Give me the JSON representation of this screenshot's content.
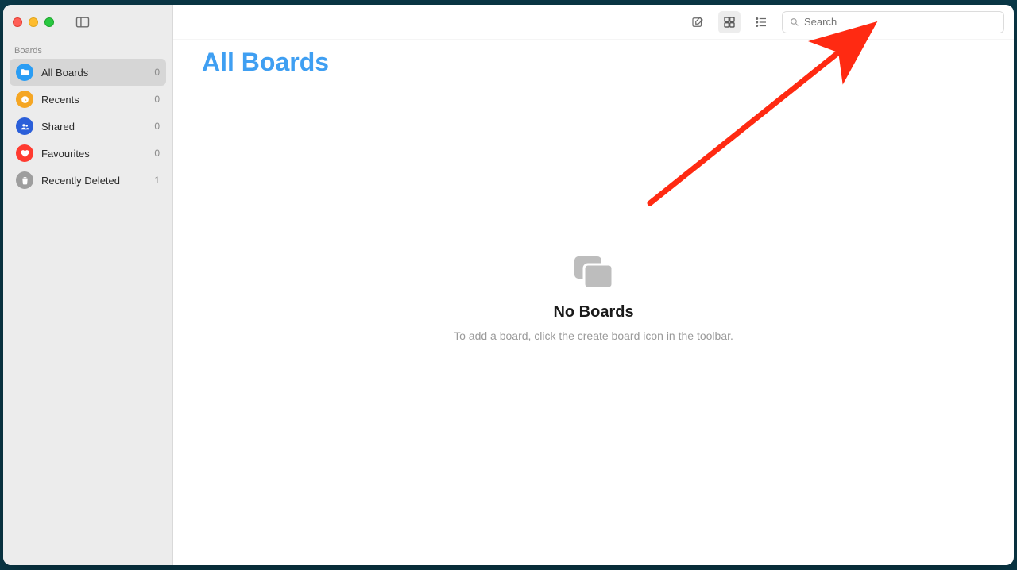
{
  "sidebar": {
    "section_label": "Boards",
    "items": [
      {
        "label": "All Boards",
        "count": "0",
        "icon": "folder-icon",
        "color": "#2a9df4",
        "active": true
      },
      {
        "label": "Recents",
        "count": "0",
        "icon": "clock-icon",
        "color": "#f5a623",
        "active": false
      },
      {
        "label": "Shared",
        "count": "0",
        "icon": "people-icon",
        "color": "#2b5fd9",
        "active": false
      },
      {
        "label": "Favourites",
        "count": "0",
        "icon": "heart-icon",
        "color": "#ff3b30",
        "active": false
      },
      {
        "label": "Recently Deleted",
        "count": "1",
        "icon": "trash-icon",
        "color": "#9e9e9e",
        "active": false
      }
    ]
  },
  "toolbar": {
    "create_board_tooltip": "Create Board",
    "grid_view_tooltip": "Grid View",
    "list_view_tooltip": "List View",
    "search_placeholder": "Search"
  },
  "page": {
    "title": "All Boards",
    "empty_title": "No Boards",
    "empty_subtitle": "To add a board, click the create board icon in the toolbar."
  },
  "annotation": {
    "type": "arrow",
    "target": "create-board-button",
    "color": "#ff2a12"
  }
}
